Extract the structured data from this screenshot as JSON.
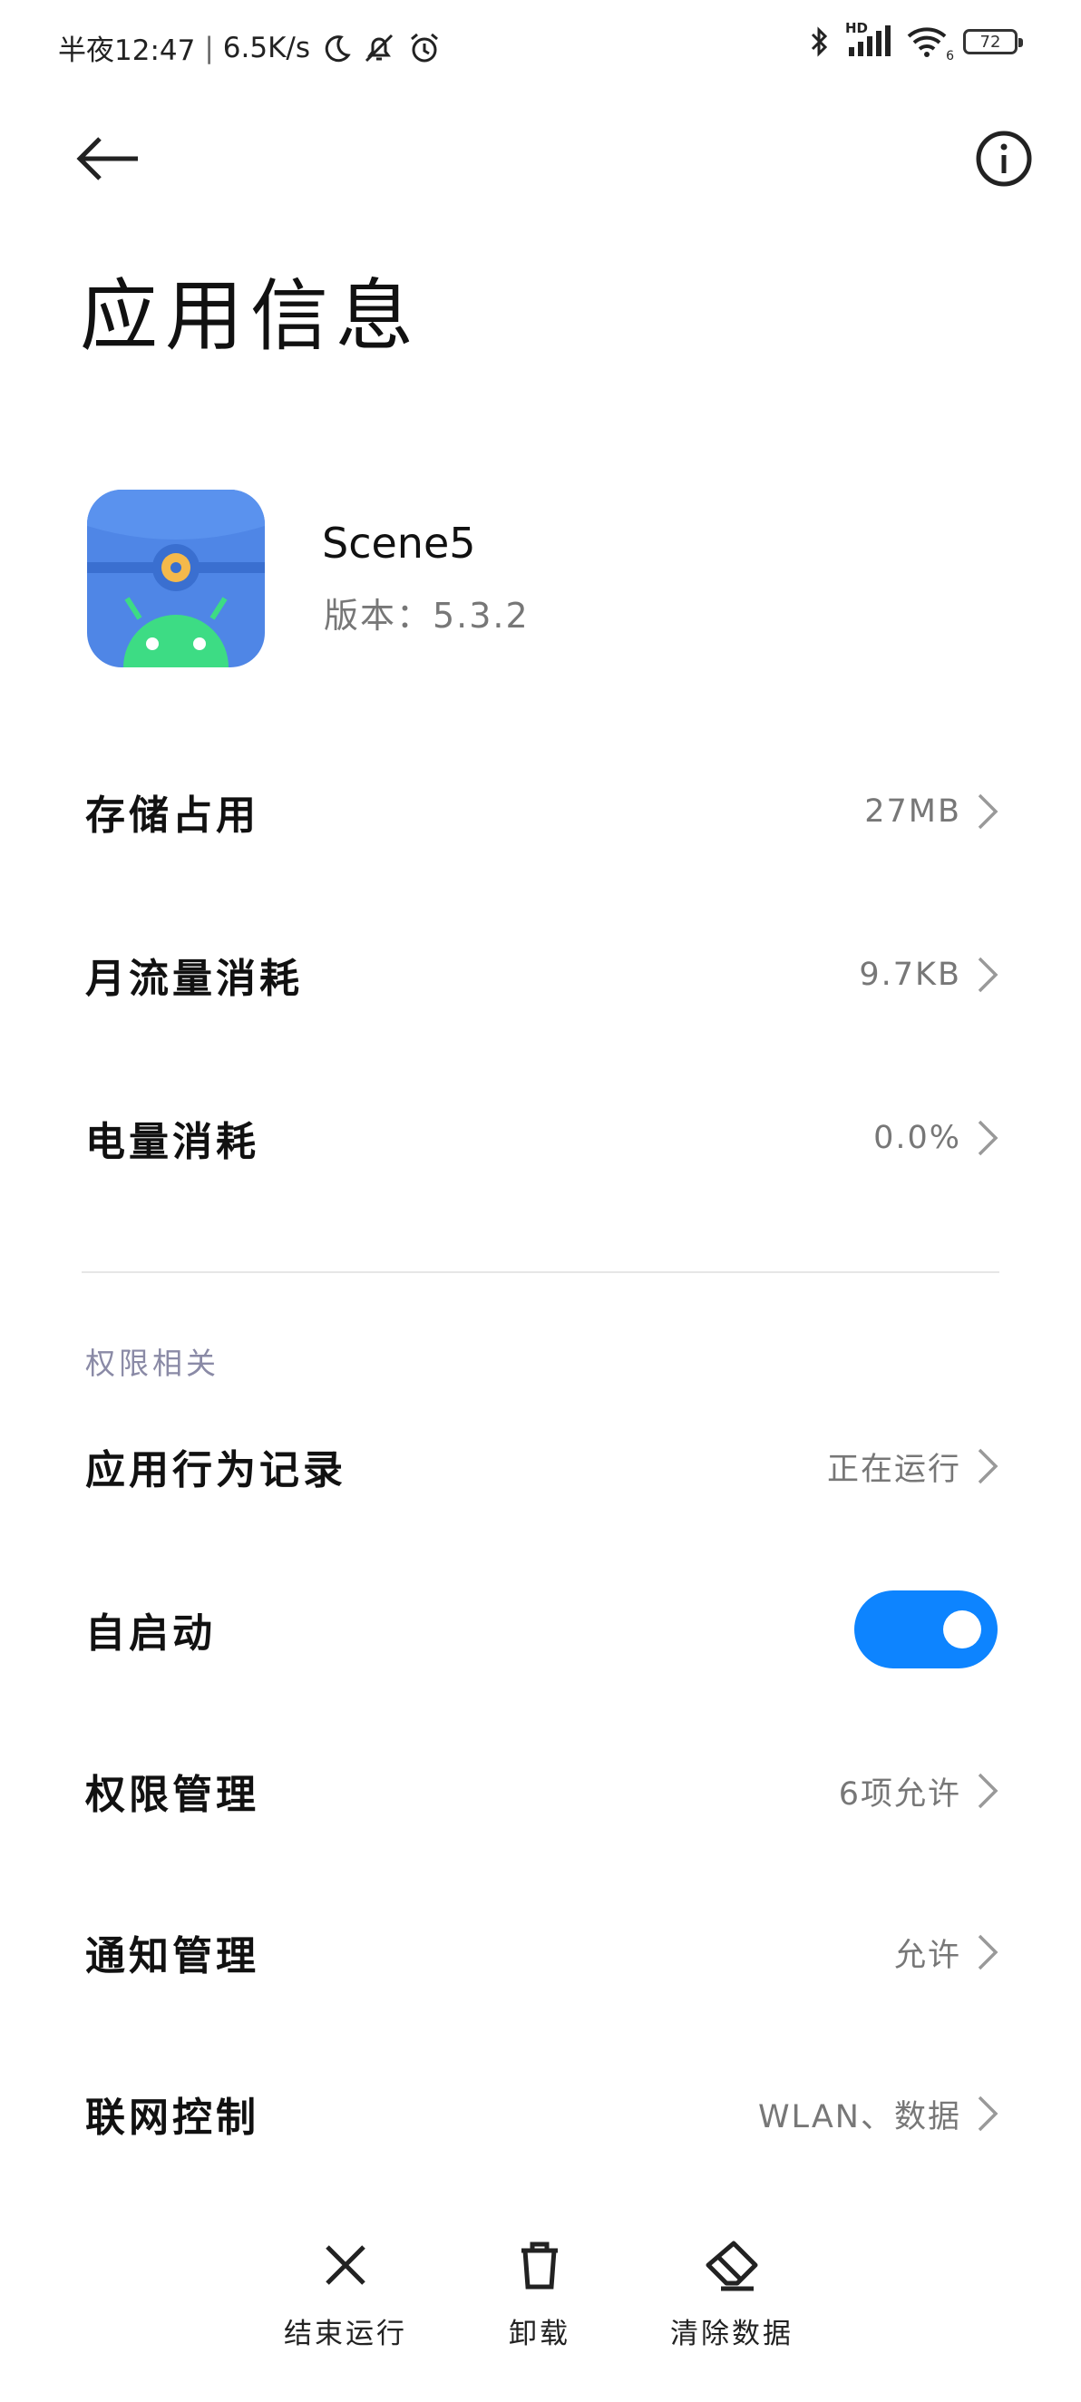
{
  "status_bar": {
    "time": "半夜12:47",
    "network_speed": "6.5K/s",
    "battery": "72",
    "wifi_label": "6",
    "hd_label": "HD",
    "icons": [
      "moon-icon",
      "bell-off-icon",
      "alarm-icon",
      "bluetooth-icon",
      "signal-icon",
      "wifi-icon",
      "battery-icon"
    ]
  },
  "header": {
    "title": "应用信息",
    "back_icon": "arrow-left-icon",
    "info_icon": "info-circle-icon"
  },
  "app": {
    "name": "Scene5",
    "version": "版本：5.3.2",
    "icon_colors": {
      "background": "#4f86e6",
      "band": "#3a6fd0",
      "gear": "#f5b94b",
      "android": "#3ddc84"
    }
  },
  "usage_rows": [
    {
      "label": "存储占用",
      "value": "27MB"
    },
    {
      "label": "月流量消耗",
      "value": "9.7KB"
    },
    {
      "label": "电量消耗",
      "value": "0.0%"
    }
  ],
  "permissions": {
    "section_title": "权限相关",
    "rows": [
      {
        "label": "应用行为记录",
        "value": "正在运行"
      },
      {
        "label": "自启动",
        "toggle_on": true
      },
      {
        "label": "权限管理",
        "value": "6项允许"
      },
      {
        "label": "通知管理",
        "value": "允许"
      },
      {
        "label": "联网控制",
        "value": "WLAN、数据"
      }
    ]
  },
  "actions": [
    {
      "label": "结束运行",
      "icon": "close-icon"
    },
    {
      "label": "卸载",
      "icon": "trash-icon"
    },
    {
      "label": "清除数据",
      "icon": "eraser-icon"
    }
  ],
  "colors": {
    "accent": "#0d84ff",
    "secondary_text": "#777777",
    "section_header": "#8a8aa6"
  }
}
